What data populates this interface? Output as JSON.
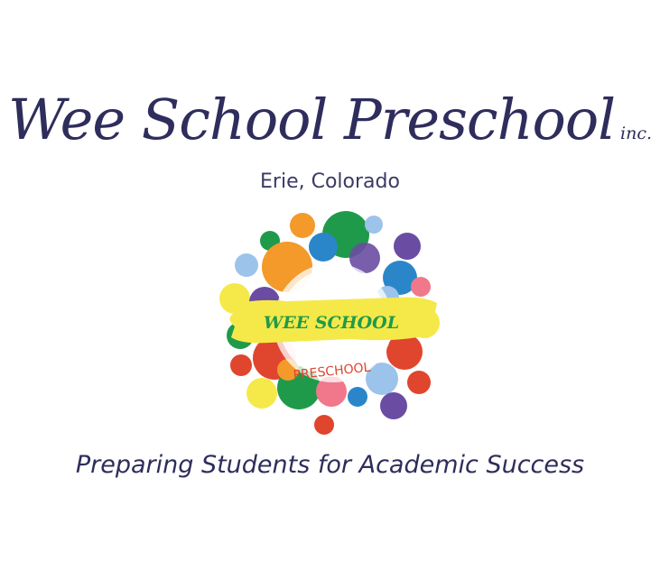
{
  "header": {
    "title": "Wee School Preschool",
    "suffix": "inc.",
    "location": "Erie, Colorado"
  },
  "logo": {
    "banner_text": "WEE SCHOOL",
    "sub_text": "PRESCHOOL",
    "colors": {
      "banner": "#f5e94a",
      "banner_text": "#1f9a4a",
      "sub_text": "#e0452d",
      "orange": "#f39a2b",
      "green": "#1f9a4a",
      "purple": "#6a4ca3",
      "blue": "#2a86c9",
      "light_blue": "#9cc3ea",
      "red": "#e0452d",
      "pink": "#f0788a",
      "yellow": "#f5e94a"
    }
  },
  "tagline": "Preparing Students for Academic Success",
  "theme": {
    "text": "#2e2d5c"
  }
}
